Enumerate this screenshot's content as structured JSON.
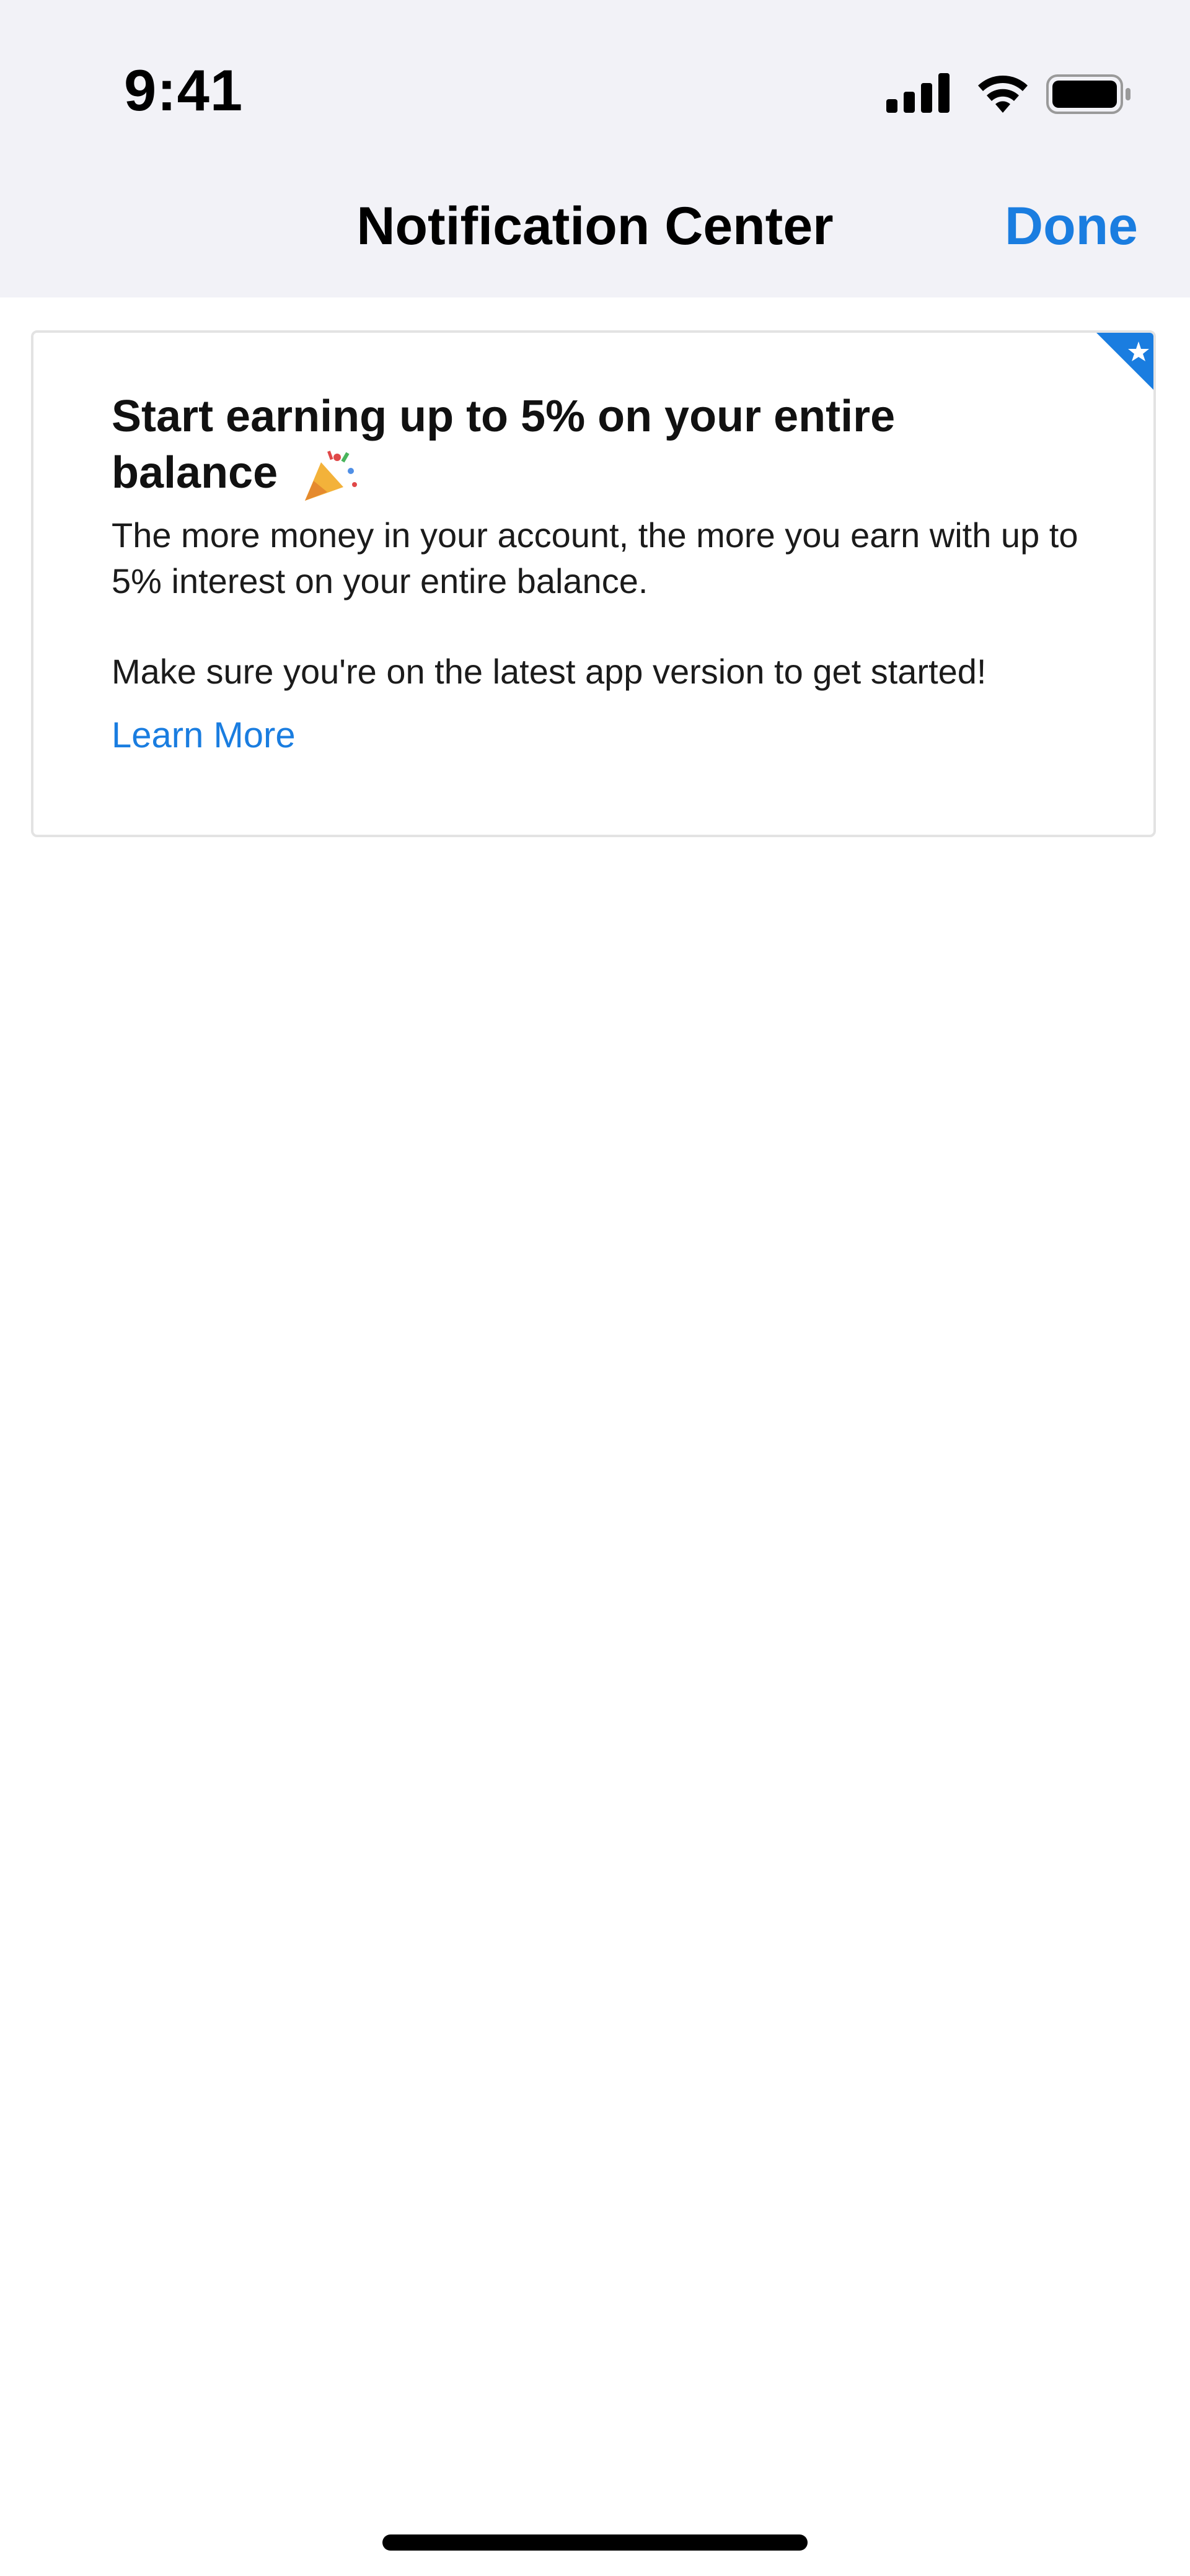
{
  "status_bar": {
    "time": "9:41",
    "icons": [
      "signal-icon",
      "wifi-icon",
      "battery-icon"
    ]
  },
  "nav": {
    "title": "Notification Center",
    "done_label": "Done"
  },
  "card": {
    "title": "Start earning up to 5% on your entire balance",
    "emoji_icon": "party-popper-icon",
    "body_line1": "The more money in your account, the more you earn with up to 5% interest on your entire balance.",
    "body_line2": "Make sure you're on the latest app version to get started!",
    "link_label": "Learn More",
    "badge_icon": "star-icon"
  },
  "colors": {
    "accent": "#1a7de0",
    "top_background": "#f2f2f7",
    "card_border": "#e3e3e3"
  }
}
